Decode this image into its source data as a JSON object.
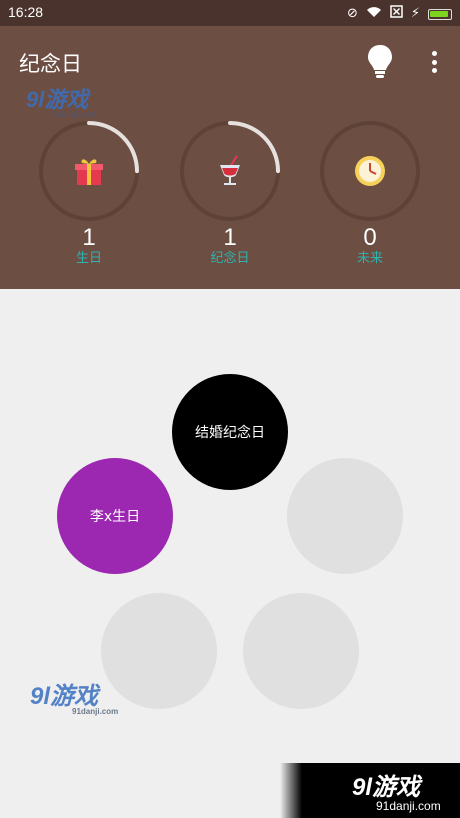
{
  "status_bar": {
    "time": "16:28",
    "icons": [
      "mute-icon",
      "wifi-icon",
      "sim-off-icon",
      "charging-icon",
      "battery-icon"
    ],
    "battery_color": "#7ed321"
  },
  "header": {
    "title": "纪念日",
    "background": "#6d4e43",
    "actions": [
      "lightbulb-icon",
      "more-vert-icon"
    ],
    "watermark": {
      "brand": "9l游戏",
      "domain": "91danji.com"
    }
  },
  "stats": [
    {
      "count": "1",
      "label": "生日",
      "icon": "gift-icon",
      "progress": 0.25
    },
    {
      "count": "1",
      "label": "纪念日",
      "icon": "cocktail-icon",
      "progress": 0.25
    },
    {
      "count": "0",
      "label": "未来",
      "icon": "clock-icon",
      "progress": 0
    }
  ],
  "label_color": "#2db3b0",
  "bubbles": [
    {
      "label": "结婚纪念日",
      "color": "#000000"
    },
    {
      "label": "李x生日",
      "color": "#9c27b0"
    },
    {
      "label": "",
      "color": "#e0e0e0"
    },
    {
      "label": "",
      "color": "#e0e0e0"
    },
    {
      "label": "",
      "color": "#e0e0e0"
    }
  ],
  "watermark_mid": {
    "brand": "9l游戏",
    "domain": "91danji.com"
  },
  "corner_logo": {
    "brand": "9l游戏",
    "domain": "91danji.com"
  }
}
